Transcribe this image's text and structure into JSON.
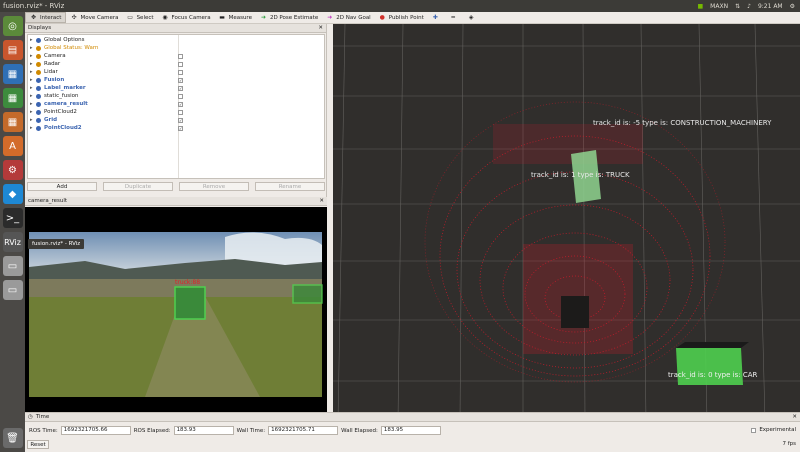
{
  "topbar": {
    "title": "fusion.rviz* - RViz",
    "tray_maxn": "MAXN",
    "clock": "9:21 AM"
  },
  "launcher": {
    "tooltip": "fusion.rviz* - RViz",
    "rviz_label": "RViz"
  },
  "toolbar": {
    "items": [
      {
        "label": "Interact",
        "icon": "interact-icon"
      },
      {
        "label": "Move Camera",
        "icon": "move-camera-icon"
      },
      {
        "label": "Select",
        "icon": "select-icon"
      },
      {
        "label": "Focus Camera",
        "icon": "focus-camera-icon"
      },
      {
        "label": "Measure",
        "icon": "measure-icon"
      },
      {
        "label": "2D Pose Estimate",
        "icon": "pose-estimate-icon"
      },
      {
        "label": "2D Nav Goal",
        "icon": "nav-goal-icon"
      },
      {
        "label": "Publish Point",
        "icon": "publish-point-icon"
      }
    ]
  },
  "displays": {
    "title": "Displays",
    "items": [
      {
        "label": "Global Options",
        "checked": null
      },
      {
        "label": "Global Status: Warn",
        "checked": null
      },
      {
        "label": "Camera",
        "checked": false
      },
      {
        "label": "Radar",
        "checked": false
      },
      {
        "label": "Lidar",
        "checked": false
      },
      {
        "label": "Fusion",
        "checked": true
      },
      {
        "label": "Label_marker",
        "checked": true
      },
      {
        "label": "static_fusion",
        "checked": false
      },
      {
        "label": "camera_result",
        "checked": true
      },
      {
        "label": "PointCloud2",
        "checked": false
      },
      {
        "label": "Grid",
        "checked": true
      },
      {
        "label": "PointCloud2",
        "checked": true
      }
    ],
    "buttons": {
      "add": "Add",
      "duplicate": "Duplicate",
      "remove": "Remove",
      "rename": "Rename"
    }
  },
  "camera_panel": {
    "title": "camera_result",
    "box_label": "truck:88"
  },
  "viewport": {
    "labels": [
      "track_id  is:  -5  type  is:  CONSTRUCTION_MACHINERY",
      "track_id  is:  1  type  is:  TRUCK",
      "track_id  is:  0  type  is:  CAR"
    ]
  },
  "time": {
    "title": "Time",
    "ros_time_label": "ROS Time:",
    "ros_time": "1692321705.66",
    "ros_elapsed_label": "ROS Elapsed:",
    "ros_elapsed": "183.93",
    "wall_time_label": "Wall Time:",
    "wall_time": "1692321705.71",
    "wall_elapsed_label": "Wall Elapsed:",
    "wall_elapsed": "183.95",
    "experimental": "Experimental",
    "reset": "Reset",
    "fps": "7 fps"
  },
  "colors": {
    "accent_blue": "#3b64b0",
    "warn": "#d08900",
    "cloud_red": "#d01a2a",
    "box_green": "#4fcf4f"
  }
}
